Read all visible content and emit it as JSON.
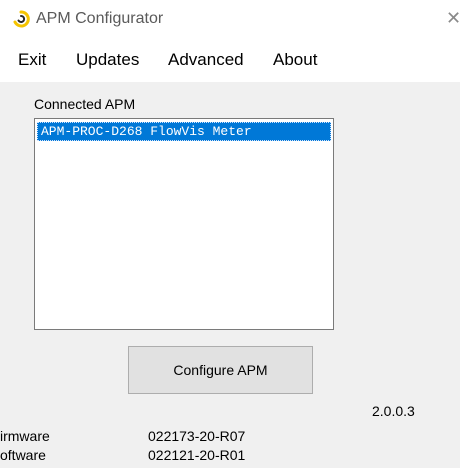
{
  "window": {
    "title": "APM Configurator",
    "close_glyph": "✕"
  },
  "menu": {
    "items": [
      {
        "label": "Exit"
      },
      {
        "label": "Updates"
      },
      {
        "label": "Advanced"
      },
      {
        "label": "About"
      }
    ]
  },
  "connected": {
    "label": "Connected APM",
    "items": [
      {
        "text": "APM-PROC-D268 FlowVis Meter",
        "selected": true
      }
    ]
  },
  "actions": {
    "configure_label": "Configure APM"
  },
  "version": "2.0.0.3",
  "info": [
    {
      "label": "irmware",
      "value": "022173-20-R07"
    },
    {
      "label": "oftware",
      "value": "022121-20-R01"
    }
  ],
  "colors": {
    "selection": "#0078d7",
    "app_icon": "#f5c400"
  },
  "icons": {
    "app": "app-logo-icon",
    "close": "close-icon"
  }
}
